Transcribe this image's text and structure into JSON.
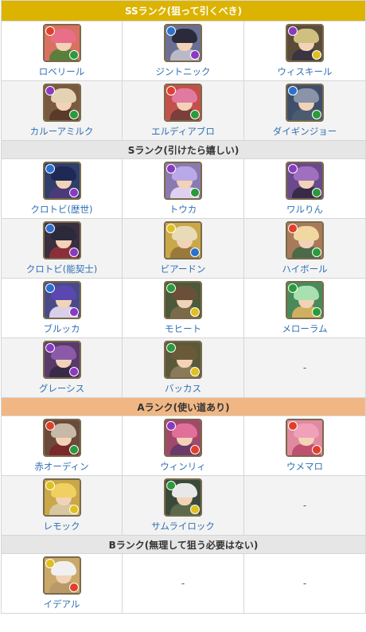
{
  "sections": [
    {
      "key": "ss",
      "title": "SSランク(狙って引くべき)",
      "bg": "#dcb300",
      "color": "#ffffff"
    },
    {
      "key": "s",
      "title": "Sランク(引けたら嬉しい)",
      "bg": "#e6e6e6",
      "color": "#333333"
    },
    {
      "key": "a",
      "title": "Aランク(使い道あり)",
      "bg": "#f0b784",
      "color": "#333333"
    },
    {
      "key": "b",
      "title": "Bランク(無理して狙う必要はない)",
      "bg": "#e6e6e6",
      "color": "#333333"
    }
  ],
  "ss": {
    "row1": [
      {
        "name": "ロベリール",
        "main": "fire",
        "sub": "wood",
        "bg": "#d97060",
        "hair": "#e86f87",
        "body": "#5a7f3a"
      },
      {
        "name": "ジントニック",
        "main": "water",
        "sub": "dark",
        "bg": "#6b6f93",
        "hair": "#2a2a3a",
        "body": "#b9b9c8"
      },
      {
        "name": "ウィスキール",
        "main": "dark",
        "sub": "light",
        "bg": "#5a4b3a",
        "hair": "#d0c080",
        "body": "#3a3540"
      }
    ],
    "row2": [
      {
        "name": "カルーアミルク",
        "main": "dark",
        "sub": "wood",
        "bg": "#7a5a3f",
        "hair": "#e4d2b4",
        "body": "#5a3b2a"
      },
      {
        "name": "エルディアブロ",
        "main": "fire",
        "sub": "wood",
        "bg": "#c4504c",
        "hair": "#e07aa0",
        "body": "#7a3f3a"
      },
      {
        "name": "ダイギンジョー",
        "main": "water",
        "sub": "wood",
        "bg": "#3f4f6a",
        "hair": "#8a93a8",
        "body": "#4b5b70"
      }
    ]
  },
  "s": {
    "row1": [
      {
        "name": "クロトビ(歴世)",
        "main": "water",
        "sub": "dark",
        "bg": "#2f3f6a",
        "hair": "#1e2a55",
        "body": "#4b3a7a"
      },
      {
        "name": "トウカ",
        "main": "dark",
        "sub": "wood",
        "bg": "#8b7ab0",
        "hair": "#b9a9e8",
        "body": "#e0d0f0"
      },
      {
        "name": "ワルりん",
        "main": "dark",
        "sub": "wood",
        "bg": "#6a4a8a",
        "hair": "#a070c0",
        "body": "#3a2a4a"
      }
    ],
    "row2": [
      {
        "name": "クロトビ(能契士)",
        "main": "water",
        "sub": "dark",
        "bg": "#3a2f3f",
        "hair": "#2a2a3a",
        "body": "#8a2f3a"
      },
      {
        "name": "ビアードン",
        "main": "light",
        "sub": "water",
        "bg": "#c9a84a",
        "hair": "#e8dcb8",
        "body": "#9a7a3a"
      },
      {
        "name": "ハイボール",
        "main": "fire",
        "sub": "wood",
        "bg": "#a87a5a",
        "hair": "#f0d8a0",
        "body": "#4a6a4a"
      }
    ],
    "row3": [
      {
        "name": "ブルッカ",
        "main": "water",
        "sub": "dark",
        "bg": "#4a4a8a",
        "hair": "#5a48b0",
        "body": "#d8d0e8"
      },
      {
        "name": "モヒート",
        "main": "wood",
        "sub": "light",
        "bg": "#4a5a3a",
        "hair": "#6a5038",
        "body": "#7a6a4a"
      },
      {
        "name": "メローラム",
        "main": "wood",
        "sub": "wood",
        "bg": "#4a8a5a",
        "hair": "#a8e0b0",
        "body": "#d0b060"
      }
    ],
    "row4": [
      {
        "name": "グレーシス",
        "main": "dark",
        "sub": "dark",
        "bg": "#5a3a6a",
        "hair": "#8a5aa8",
        "body": "#3a2a4a"
      },
      {
        "name": "バッカス",
        "main": "wood",
        "sub": "light",
        "bg": "#5a5a3a",
        "hair": "#6a5a3a",
        "body": "#8a7a5a"
      },
      {
        "empty": "-"
      }
    ]
  },
  "a": {
    "row1": [
      {
        "name": "赤オーディン",
        "main": "fire",
        "sub": "wood",
        "bg": "#6a4a3a",
        "hair": "#c8b8a8",
        "body": "#7a2a2a"
      },
      {
        "name": "ウィンリィ",
        "main": "dark",
        "sub": "fire",
        "bg": "#a04a6a",
        "hair": "#e0709a",
        "body": "#6a3a6a"
      },
      {
        "name": "ウメマロ",
        "main": "fire",
        "sub": "fire",
        "bg": "#e08aa0",
        "hair": "#f0a0b8",
        "body": "#c05070"
      }
    ],
    "row2": [
      {
        "name": "レモック",
        "main": "light",
        "sub": "light",
        "bg": "#c9a84a",
        "hair": "#f0d060",
        "body": "#d8c8a0"
      },
      {
        "name": "サムライロック",
        "main": "wood",
        "sub": "light",
        "bg": "#3a4a3a",
        "hair": "#e8e8e8",
        "body": "#5a6a4a"
      },
      {
        "empty": "-"
      }
    ]
  },
  "b": {
    "row1": [
      {
        "name": "イデアル",
        "main": "light",
        "sub": "fire",
        "bg": "#c9a86a",
        "hair": "#f0f0f0",
        "body": "#b89a6a"
      },
      {
        "empty": "-"
      },
      {
        "empty": "-"
      }
    ]
  },
  "attribute_colors": {
    "fire": "#e0402a",
    "water": "#2a70d0",
    "wood": "#2a9a3a",
    "light": "#e0c020",
    "dark": "#8a3ac0"
  }
}
